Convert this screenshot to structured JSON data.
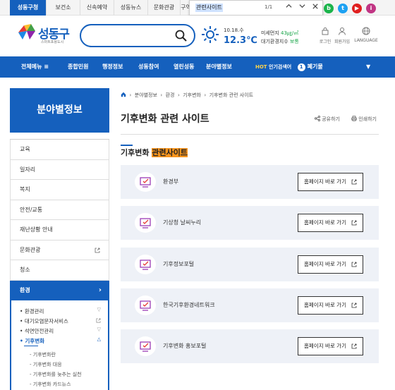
{
  "top_tabs": [
    "성동구청",
    "보건소",
    "신속예약",
    "성동뉴스",
    "문화관광",
    "구역"
  ],
  "find_bar": {
    "query": "관련사이트",
    "count": "1/1"
  },
  "social": [
    {
      "letter": "b",
      "color": "#1bb44b"
    },
    {
      "letter": "t",
      "color": "#1da1f2"
    },
    {
      "letter": "▶",
      "color": "#e02020"
    },
    {
      "letter": "i",
      "color": "#c13584"
    }
  ],
  "logo": {
    "name": "성동구",
    "sub": "스마트포용도시"
  },
  "weather": {
    "date": "10.18.수",
    "temp": "12.3℃"
  },
  "air": {
    "label1": "미세먼지",
    "value1": "43㎍/㎥",
    "label2": "대기환경지수",
    "value2": "보통"
  },
  "util": [
    "로그인",
    "회원가입",
    "LANGUAGE"
  ],
  "gnb": {
    "all_menu": "전체메뉴",
    "items": [
      "종합민원",
      "행정정보",
      "성동참여",
      "열린성동",
      "분야별정보"
    ],
    "hot_label": "HOT",
    "hot_sub": "인기검색어",
    "hot_rank": "1",
    "hot_word": "폐기물"
  },
  "sidebar": {
    "title": "분야별정보",
    "items": [
      "교육",
      "일자리",
      "복지",
      "안전/교통",
      "재난상황 안내",
      "문화관광",
      "청소",
      "환경"
    ],
    "sub": [
      "환경관리",
      "대기오염문자서비스",
      "석면안전관리",
      "기후변화"
    ],
    "subsub": [
      "기후변화란",
      "기후변화 대응",
      "기후변화를 늦추는 실천",
      "기후변화 카드뉴스"
    ]
  },
  "breadcrumb": [
    "분야별정보",
    "환경",
    "기후변화",
    "기후변화 관련 사이트"
  ],
  "page": {
    "title": "기후변화 관련 사이트",
    "share": "공유하기",
    "print": "인쇄하기"
  },
  "section": {
    "title_plain": "기후변화",
    "title_highlight": "관련사이트"
  },
  "sites": [
    {
      "name": "환경부",
      "button": "홈페이지 바로 가기"
    },
    {
      "name": "기상청 날씨누리",
      "button": "홈페이지 바로 가기"
    },
    {
      "name": "기후정보포털",
      "button": "홈페이지 바로 가기"
    },
    {
      "name": "한국기후환경네트워크",
      "button": "홈페이지 바로 가기"
    },
    {
      "name": "기후변화 홍보포털",
      "button": "홈페이지 바로 가기"
    }
  ],
  "colors": {
    "brand": "#1560bd",
    "highlight": "#f7941d",
    "hot": "#ffd54a"
  }
}
